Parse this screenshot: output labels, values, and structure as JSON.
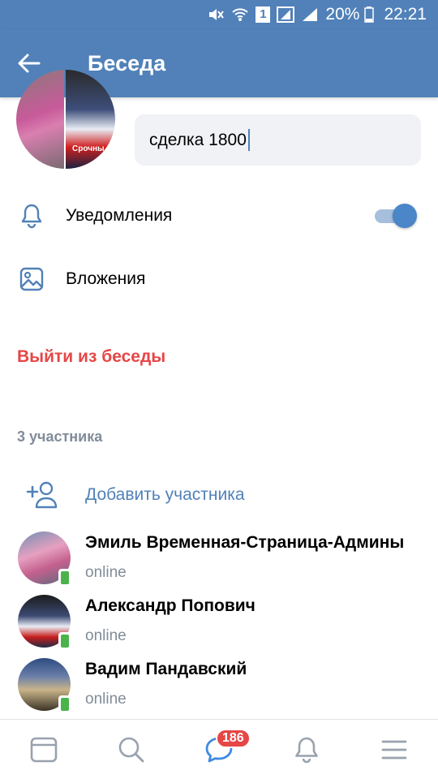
{
  "status_bar": {
    "battery": "20%",
    "time": "22:21",
    "sim_badge": "1"
  },
  "header": {
    "title": "Беседа"
  },
  "chat": {
    "name_value": "сделка 1800",
    "avatar_caption": "Срочны"
  },
  "settings": {
    "notifications_label": "Уведомления",
    "notifications_enabled": true,
    "attachments_label": "Вложения"
  },
  "leave_label": "Выйти из беседы",
  "members_count_label": "3 участника",
  "add_member_label": "Добавить участника",
  "members": [
    {
      "name": "Эмиль Временная-Страница-Админы",
      "status": "online"
    },
    {
      "name": "Александр Попович",
      "status": "online"
    },
    {
      "name": "Вадим Пандавский",
      "status": "online"
    }
  ],
  "bottom_nav": {
    "messages_badge": "186"
  },
  "colors": {
    "brand": "#5181b8",
    "danger": "#e64646",
    "online": "#4bb34b",
    "muted": "#818c99"
  }
}
